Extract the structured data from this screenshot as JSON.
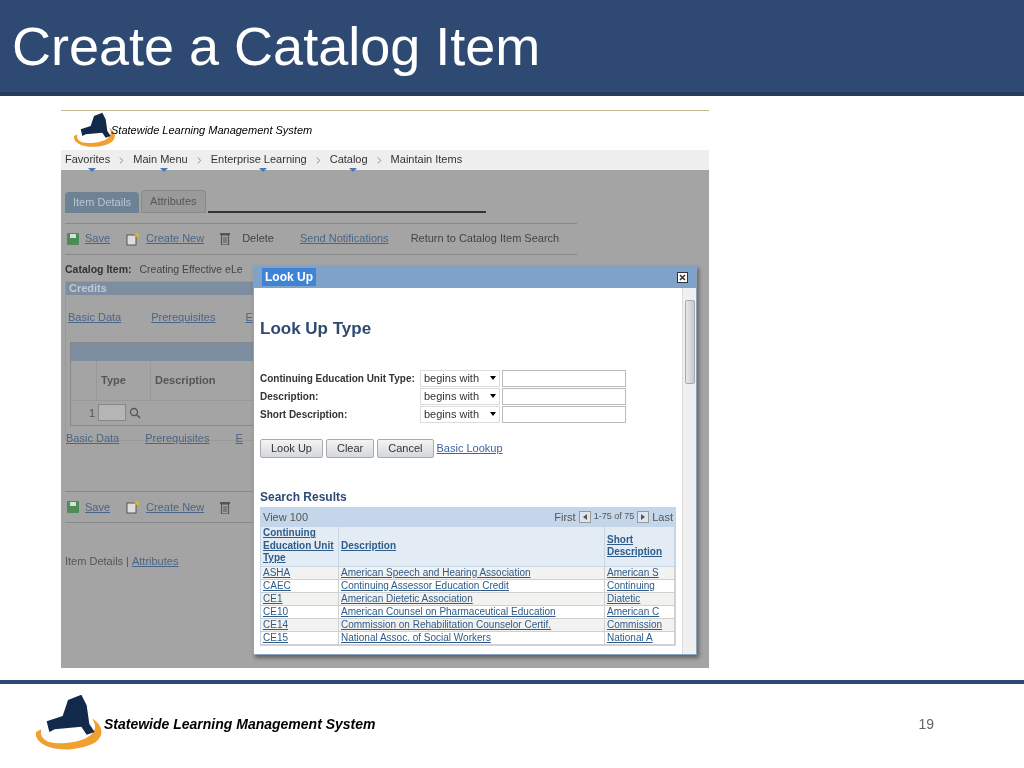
{
  "slide": {
    "title": "Create a Catalog Item",
    "footer_brand": "Statewide Learning Management System",
    "page_number": "19"
  },
  "app": {
    "brand": "Statewide Learning Management System",
    "breadcrumbs": [
      {
        "label": "Favorites",
        "has_menu": true
      },
      {
        "label": "Main Menu",
        "has_menu": true
      },
      {
        "label": "Enterprise Learning",
        "has_menu": true
      },
      {
        "label": "Catalog",
        "has_menu": true
      },
      {
        "label": "Maintain Items",
        "has_menu": false
      }
    ],
    "tabs": [
      {
        "label": "Item Details",
        "selected": true
      },
      {
        "label": "Attributes",
        "selected": false
      }
    ],
    "toolbar": [
      {
        "label": "Save",
        "kind": "save"
      },
      {
        "label": "Create New",
        "kind": "new"
      },
      {
        "label": "Delete",
        "kind": "delete"
      },
      {
        "label": "Send Notifications",
        "kind": "link"
      },
      {
        "label": "Return to Catalog Item Search",
        "kind": "text"
      }
    ],
    "catalog_item": {
      "label": "Catalog Item:",
      "value": "Creating Effective eLe"
    },
    "credits": {
      "title": "Credits",
      "links": [
        "Basic Data",
        "Prerequisites",
        "E"
      ],
      "columns": [
        "Type",
        "Description"
      ],
      "row_number": "1",
      "links_bottom": [
        "Basic Data",
        "Prerequisites",
        "E"
      ]
    },
    "bottom_toolbar": [
      {
        "label": "Save",
        "kind": "save"
      },
      {
        "label": "Create New",
        "kind": "new"
      },
      {
        "kind": "delete"
      }
    ],
    "footer_links": {
      "current": "Item Details",
      "separator": "|",
      "link": "Attributes"
    }
  },
  "dialog": {
    "title": "Look Up",
    "heading": "Look Up Type",
    "fields": [
      {
        "label": "Continuing Education Unit Type:",
        "operator": "begins with"
      },
      {
        "label": "Description:",
        "operator": "begins with"
      },
      {
        "label": "Short Description:",
        "operator": "begins with"
      }
    ],
    "buttons": [
      "Look Up",
      "Clear",
      "Cancel"
    ],
    "link": "Basic Lookup",
    "results": {
      "title": "Search Results",
      "view": "View 100",
      "first": "First",
      "range": "1-75 of 75",
      "last": "Last",
      "columns": [
        "Continuing Education Unit Type",
        "Description",
        "Short Description"
      ],
      "rows": [
        [
          "ASHA",
          "American Speech and Hearing Association",
          "American S"
        ],
        [
          "CAEC",
          "Continuing Assessor Education Credit",
          "Continuing"
        ],
        [
          "CE1",
          "American Dietetic Association",
          "Diatetic"
        ],
        [
          "CE10",
          "American Counsel on Pharmaceutical Education",
          "American C"
        ],
        [
          "CE14",
          "Commission on Rehabilitation Counselor Certif.",
          "Commission"
        ],
        [
          "CE15",
          "National Assoc. of Social Workers",
          "National A"
        ]
      ]
    }
  }
}
